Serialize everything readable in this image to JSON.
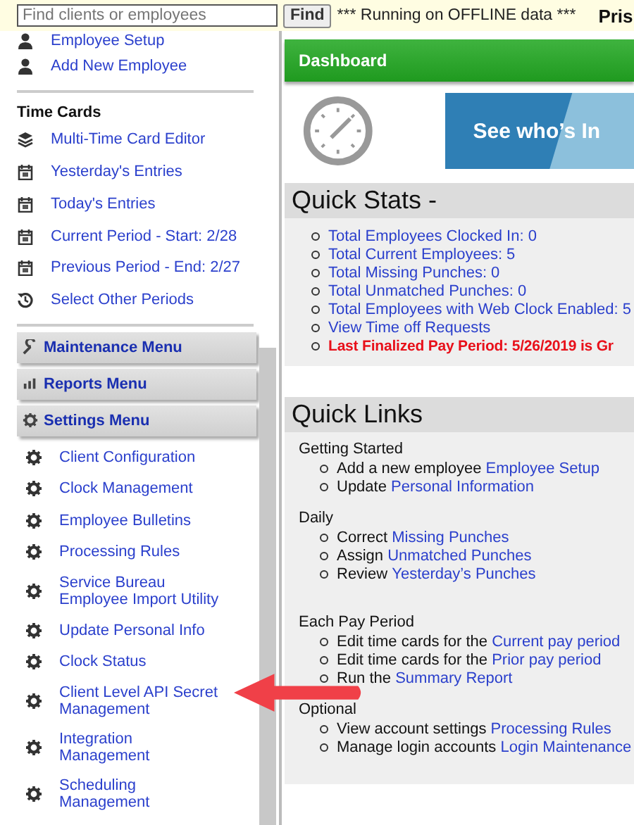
{
  "topbar": {
    "search": {
      "placeholder": "Find clients or employees"
    },
    "find_button": "Find",
    "status": "*** Running on OFFLINE data ***",
    "title": "Pris"
  },
  "sidebar": {
    "top_items": [
      "Employee Setup",
      "Add New Employee"
    ],
    "time_cards": {
      "heading": "Time Cards",
      "items": [
        "Multi-Time Card Editor",
        "Yesterday's Entries",
        "Today's Entries",
        "Current Period - Start: 2/28",
        "Previous Period - End: 2/27",
        "Select Other Periods"
      ]
    },
    "menus": [
      "Maintenance Menu",
      "Reports Menu",
      "Settings Menu"
    ],
    "settings_items": [
      "Client Configuration",
      "Clock Management",
      "Employee Bulletins",
      "Processing Rules",
      "Service Bureau Employee Import Utility",
      "Update Personal Info",
      "Clock Status",
      "Client Level API Secret Management",
      "Integration Management",
      "Scheduling Management"
    ]
  },
  "dashboard": {
    "title": "Dashboard",
    "banner": "See who’s In",
    "quick_stats": {
      "title": "Quick Stats -",
      "items": [
        {
          "text": "Total Employees Clocked In: 0",
          "kind": "link"
        },
        {
          "text": "Total Current Employees: 5",
          "kind": "link"
        },
        {
          "text": "Total Missing Punches: 0",
          "kind": "link"
        },
        {
          "text": "Total Unmatched Punches: 0",
          "kind": "link"
        },
        {
          "text": "Total Employees with Web Clock Enabled: 5",
          "kind": "link"
        },
        {
          "text": "View Time off Requests",
          "kind": "link"
        },
        {
          "text": "Last Finalized Pay Period: 5/26/2019 is Gr",
          "kind": "alert"
        }
      ]
    },
    "quick_links": {
      "title": "Quick Links",
      "groups": [
        {
          "heading": "Getting Started",
          "items": [
            {
              "prefix": "Add a new employee",
              "link": "Employee Setup"
            },
            {
              "prefix": "Update",
              "link": "Personal Information"
            }
          ]
        },
        {
          "heading": "Daily",
          "items": [
            {
              "prefix": "Correct",
              "link": "Missing Punches"
            },
            {
              "prefix": "Assign",
              "link": "Unmatched Punches"
            },
            {
              "prefix": "Review",
              "link": "Yesterday’s Punches"
            }
          ]
        },
        {
          "heading": "Each Pay Period",
          "items": [
            {
              "prefix": "Edit time cards for the",
              "link": "Current pay period"
            },
            {
              "prefix": "Edit time cards for the",
              "link": "Prior pay period"
            },
            {
              "prefix": "Run the",
              "link": "Summary Report"
            }
          ]
        },
        {
          "heading": "Optional",
          "items": [
            {
              "prefix": "View account settings",
              "link": "Processing Rules"
            },
            {
              "prefix": "Manage login accounts",
              "link": "Login Maintenance"
            }
          ]
        }
      ]
    }
  }
}
